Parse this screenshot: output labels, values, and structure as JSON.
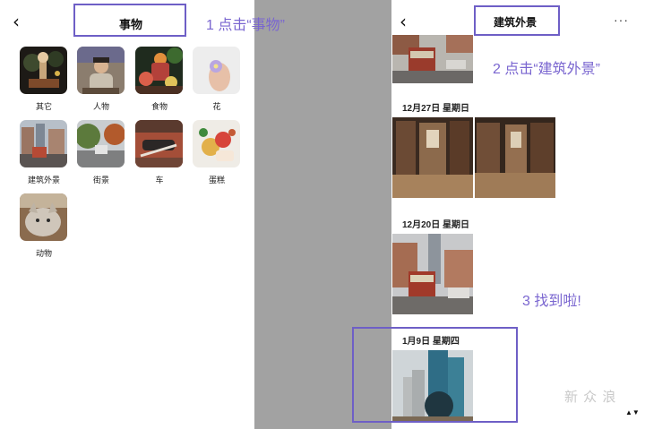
{
  "left_panel": {
    "back_glyph": "‹",
    "title": "事物",
    "callout": "1 点击“事物”",
    "categories": [
      {
        "label": "其它",
        "icon": "other-thumb-icon"
      },
      {
        "label": "人物",
        "icon": "person-thumb-icon"
      },
      {
        "label": "食物",
        "icon": "food-thumb-icon"
      },
      {
        "label": "花",
        "icon": "flower-thumb-icon"
      },
      {
        "label": "建筑外景",
        "icon": "building-thumb-icon"
      },
      {
        "label": "街景",
        "icon": "street-thumb-icon"
      },
      {
        "label": "车",
        "icon": "car-thumb-icon"
      },
      {
        "label": "蛋糕",
        "icon": "cake-thumb-icon"
      },
      {
        "label": "动物",
        "icon": "animal-thumb-icon"
      }
    ]
  },
  "right_panel": {
    "back_glyph": "‹",
    "title": "建筑外景",
    "more_glyph": "···",
    "callout_2": "2 点击“建筑外景”",
    "callout_3": "3 找到啦!",
    "sections": [
      {
        "date": "12月27日 星期日"
      },
      {
        "date": "12月20日 星期日"
      },
      {
        "date": "1月9日 星期四"
      }
    ],
    "watermark": "新 众 浪",
    "scroll_glyph": "▲▼"
  },
  "colors": {
    "accent": "#6e5fc6",
    "callout_text": "#7a66d0",
    "background": "#a2a2a2"
  }
}
